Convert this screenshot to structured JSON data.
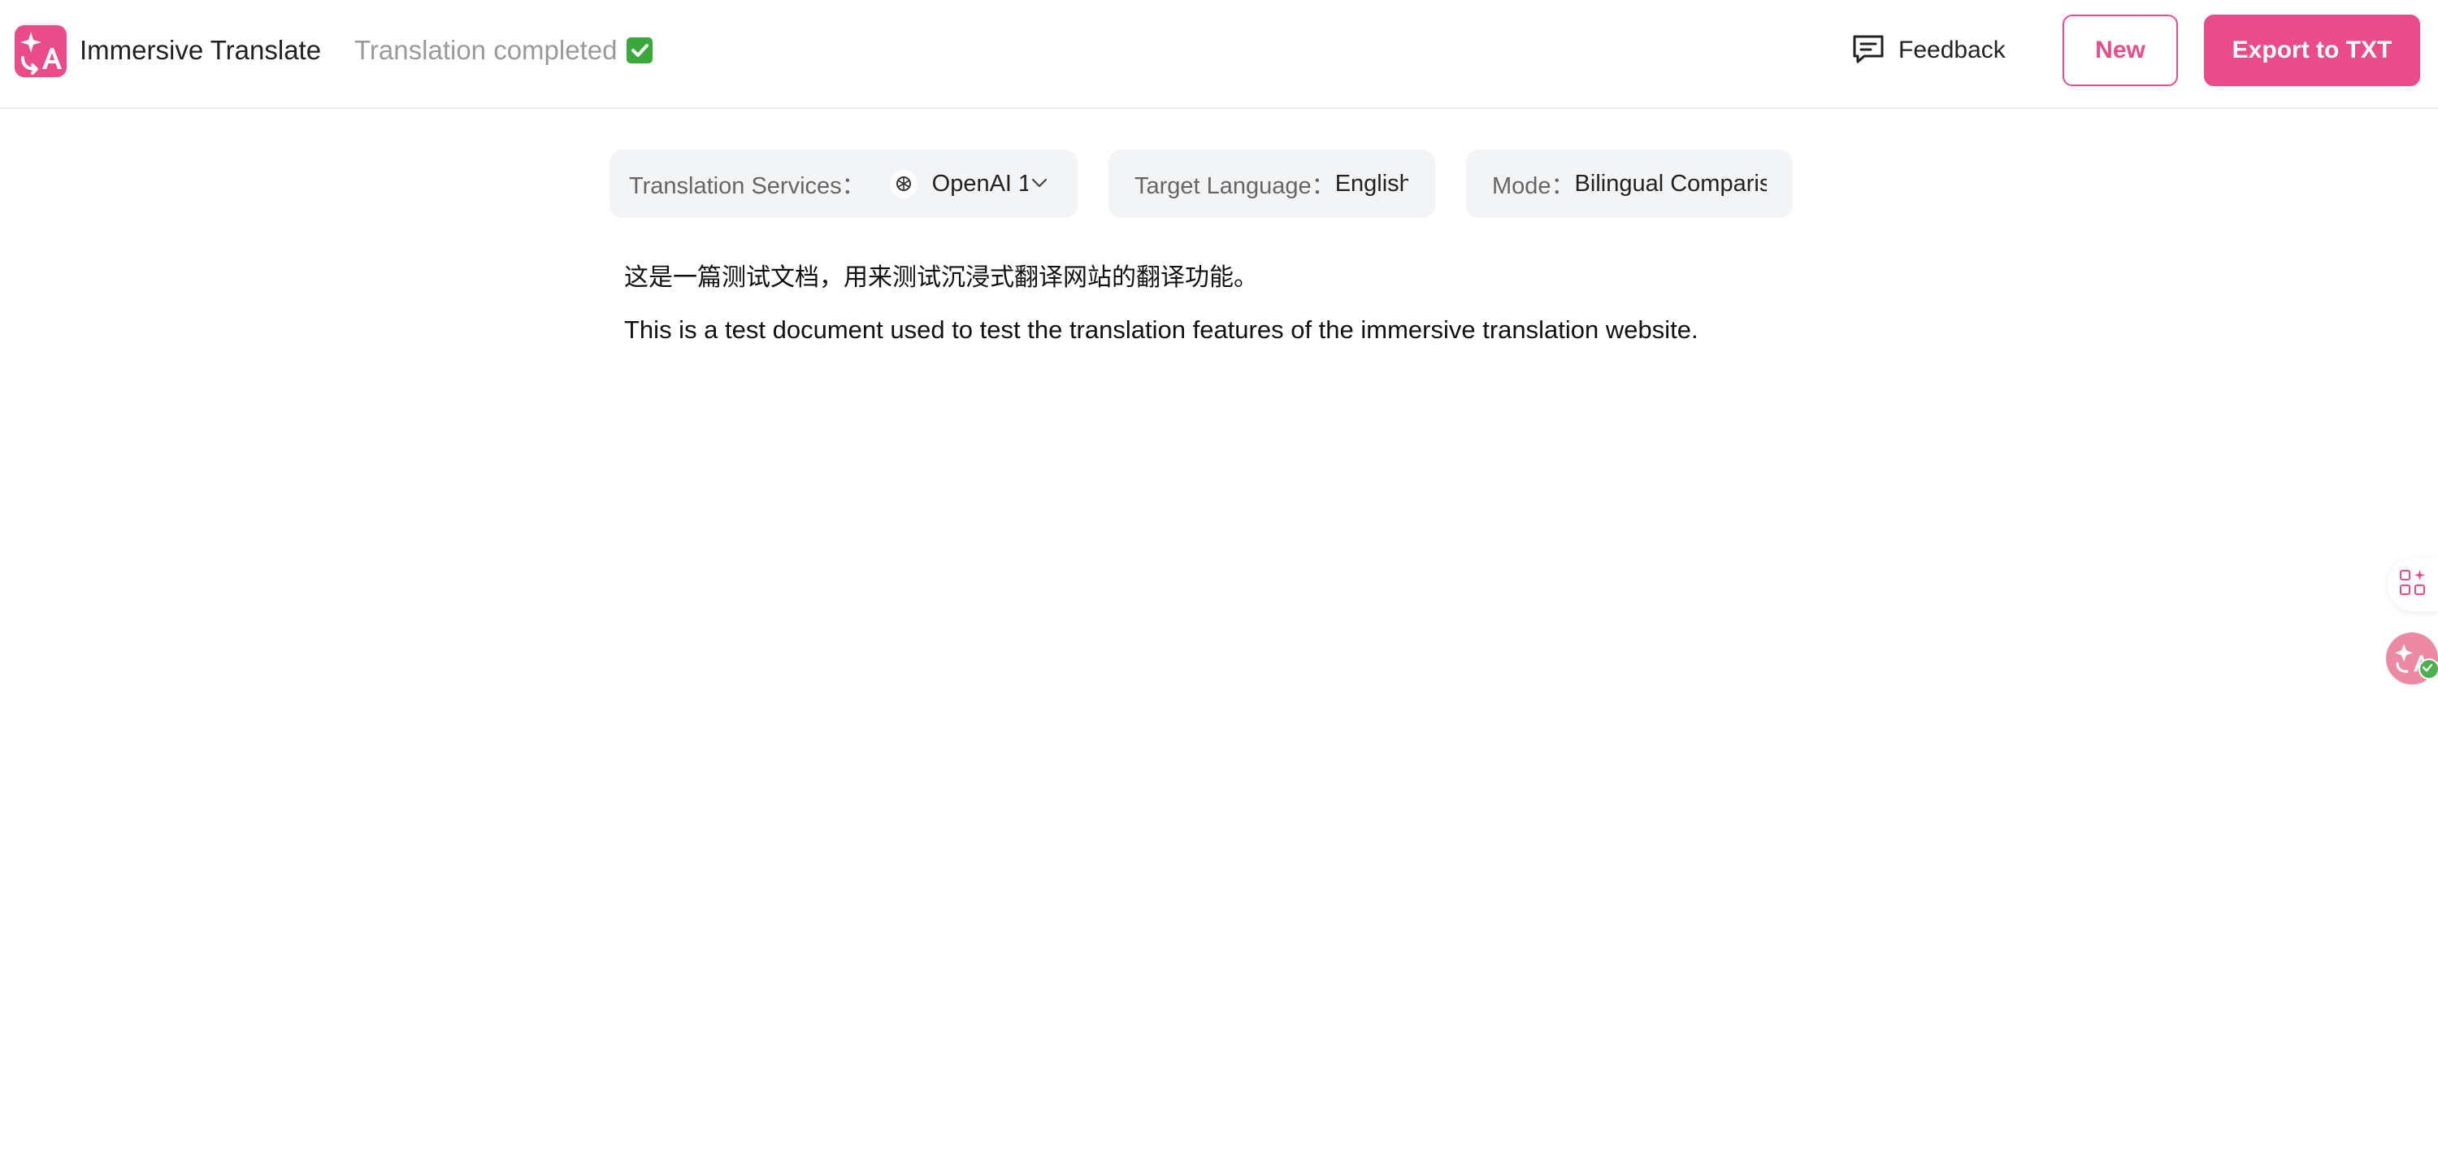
{
  "header": {
    "app_title": "Immersive Translate",
    "status_text": "Translation completed",
    "status_icon": "check-mark-button-emoji",
    "feedback_label": "Feedback",
    "new_label": "New",
    "export_label": "Export to TXT"
  },
  "settings": {
    "services_label": "Translation Services：",
    "services_value": "OpenAI 1",
    "target_label": "Target Language：",
    "target_value": "English",
    "mode_label": "Mode：",
    "mode_value": "Bilingual Comparison"
  },
  "content": {
    "original": "这是一篇测试文档，用来测试沉浸式翻译网站的翻译功能。",
    "translated": "This is a test document used to test the translation features of the immersive translation website."
  },
  "colors": {
    "accent": "#ea4c89",
    "status_text": "#9a9a9a",
    "pill_bg": "#f3f4f6"
  }
}
